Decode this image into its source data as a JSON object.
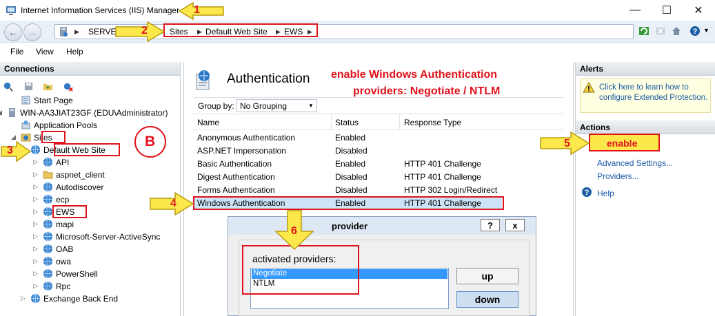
{
  "window": {
    "title": "Internet Information Services (IIS) Manager",
    "minimize": "—",
    "maximize": "☐",
    "close": "✕"
  },
  "address": {
    "server": "SERVE",
    "crumbs": [
      "Sites",
      "Default Web Site",
      "EWS"
    ]
  },
  "menu": [
    "File",
    "View",
    "Help"
  ],
  "connections": {
    "header": "Connections",
    "tree": [
      {
        "label": "Start Page",
        "icon": "start-page-icon"
      },
      {
        "label": "WIN-AA3JIAT23GF (EDU\\Administrator)",
        "icon": "server-icon"
      },
      {
        "label": "Application Pools",
        "icon": "app-pools-icon"
      },
      {
        "label": "Sites",
        "icon": "sites-icon"
      },
      {
        "label": "Default Web Site",
        "icon": "globe-icon"
      },
      {
        "label": "API",
        "icon": "globe-icon"
      },
      {
        "label": "aspnet_client",
        "icon": "folder-icon"
      },
      {
        "label": "Autodiscover",
        "icon": "globe-icon"
      },
      {
        "label": "ecp",
        "icon": "globe-icon"
      },
      {
        "label": "EWS",
        "icon": "globe-icon"
      },
      {
        "label": "mapi",
        "icon": "globe-icon"
      },
      {
        "label": "Microsoft-Server-ActiveSync",
        "icon": "globe-icon"
      },
      {
        "label": "OAB",
        "icon": "globe-icon"
      },
      {
        "label": "owa",
        "icon": "globe-icon"
      },
      {
        "label": "PowerShell",
        "icon": "globe-icon"
      },
      {
        "label": "Rpc",
        "icon": "globe-icon"
      },
      {
        "label": "Exchange Back End",
        "icon": "globe-icon"
      }
    ]
  },
  "feature": {
    "title": "Authentication",
    "group_by_label": "Group by:",
    "group_by_value": "No Grouping",
    "columns": [
      "Name",
      "Status",
      "Response Type"
    ],
    "rows": [
      {
        "name": "Anonymous Authentication",
        "status": "Enabled",
        "response": ""
      },
      {
        "name": "ASP.NET Impersonation",
        "status": "Disabled",
        "response": ""
      },
      {
        "name": "Basic Authentication",
        "status": "Enabled",
        "response": "HTTP 401 Challenge"
      },
      {
        "name": "Digest Authentication",
        "status": "Disabled",
        "response": "HTTP 401 Challenge"
      },
      {
        "name": "Forms Authentication",
        "status": "Disabled",
        "response": "HTTP 302 Login/Redirect"
      },
      {
        "name": "Windows Authentication",
        "status": "Enabled",
        "response": "HTTP 401 Challenge"
      }
    ]
  },
  "annotation": {
    "line1": "enable Windows Authentication",
    "line2": "providers: Negotiate / NTLM",
    "badge_b": "B",
    "numbers": [
      "1",
      "2",
      "3",
      "4",
      "5",
      "6"
    ],
    "enable_label": "enable"
  },
  "alerts": {
    "header": "Alerts",
    "message": "Click here to learn how to configure Extended Protection."
  },
  "actions": {
    "header": "Actions",
    "items": [
      "Advanced Settings...",
      "Providers...",
      "Help"
    ]
  },
  "dialog": {
    "title": "provider",
    "help_btn": "?",
    "close_btn": "x",
    "list_label": "activated providers:",
    "providers": [
      "Negotiate",
      "NTLM"
    ],
    "up_btn": "up",
    "down_btn": "down"
  },
  "colors": {
    "accent_red": "#e0121b",
    "callout_yellow": "#fce84a",
    "link_blue": "#1a5aa6",
    "selection_blue": "#3399ff"
  }
}
